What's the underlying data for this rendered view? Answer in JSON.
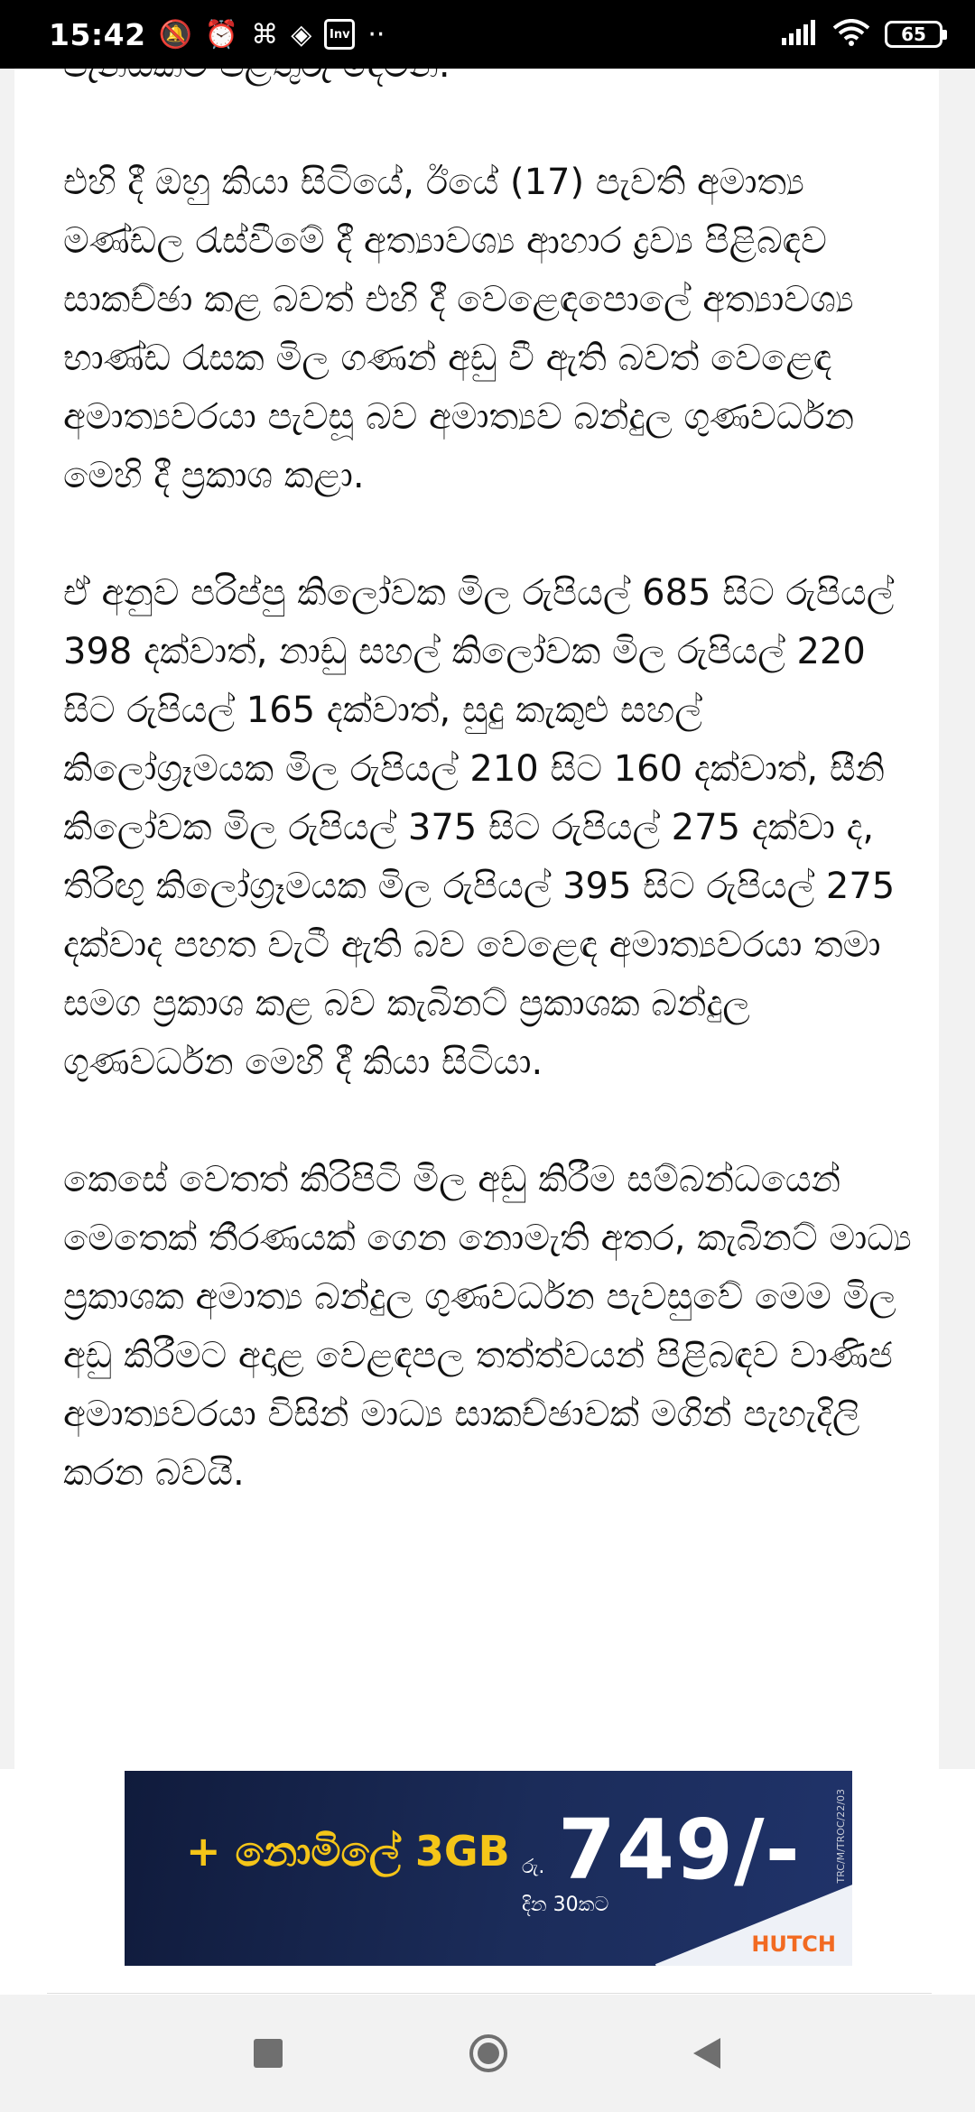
{
  "status_bar": {
    "time": "15:42",
    "icons": [
      "mute-notifications-icon",
      "alarm-icon",
      "app-grid-icon",
      "binance-icon",
      "invest-app-icon",
      "more-notifications-icon"
    ],
    "invest_label": "Inv",
    "more_dots": "··",
    "signal_icon": "signal-bars-icon",
    "wifi_icon": "wifi-icon",
    "battery_level": "65"
  },
  "article": {
    "paragraphs": [
      "පැනයකට පිළිතුරු දෙමින්.",
      "එහි දී ඔහු කියා සිටියේ, ඊයේ (17) පැවති අමාත්‍ය මණ්ඩල රැස්වීමේ දී අත්‍යාවශ්‍ය ආහාර ද්‍රව්‍ය පිළිබඳව සාකච්ඡා කළ බවත් එහි දී වෙළෙඳපොලේ අත්‍යාවශ්‍ය භාණ්ඩ රැසක මිල ගණන් අඩු වී ඇති බවත් වෙළෙඳ අමාත්‍යවරයා පැවසූ බව අමාත්‍යව බන්දුල ගුණවර්ධන මෙහි දී ප්‍රකාශ කළා.",
      "ඒ අනුව පරිප්පු කිලෝවක මිල රුපියල් 685 සිට රුපියල් 398 දක්වාත්, නාඩු සහල් කිලෝවක මිල රුපියල් 220 සිට රුපියල් 165 දක්වාත්, සුදු කැකුළු සහල් කිලෝග්‍රෑමයක මිල රුපියල් 210 සිට 160 දක්වාත්, සීනි කිලෝවක මිල රුපියල් 375 සිට රුපියල් 275 දක්වා ද, තිරිඟු කිලෝග්‍රෑමයක මිල රුපියල් 395 සිට රුපියල් 275 දක්වාද පහත වැටී ඇති බව වෙළෙඳ අමාත්‍යවරයා තමා සමග ප්‍රකාශ කළ බව කැබිනට් ප්‍රකාශක බන්දුල ගුණවර්ධන මෙහි දී කියා සිටියා.",
      "කෙසේ වෙතත් කිරිපිටි මිල අඩු කිරීම සම්බන්ධයෙන් මෙතෙක් තීරණයක් ගෙන නොමැති අතර, කැබිනට් මාධ්‍ය ප්‍රකාශක අමාත්‍ය බන්දුල ගුණවර්ධන පැවසුවේ මෙම මිල අඩු කිරීමට අදාළ වෙළඳපල තත්ත්වයන් පිළිබඳව වාණිජ අමාත්‍යවරයා විසින් මාධ්‍ය සාකච්ඡාවක් මගින් පැහැදිලි කරන බවයි."
    ]
  },
  "ad": {
    "headline": "+ නොමිලේ 3GB",
    "currency": "රු.",
    "price": "749/-",
    "duration": "දින 30කට",
    "brand": "HUTCH",
    "code": "TRC/M/TROC/22/03"
  },
  "nav_bar": {
    "recents_icon": "recents-square-icon",
    "home_icon": "home-circle-icon",
    "back_icon": "back-triangle-icon"
  }
}
